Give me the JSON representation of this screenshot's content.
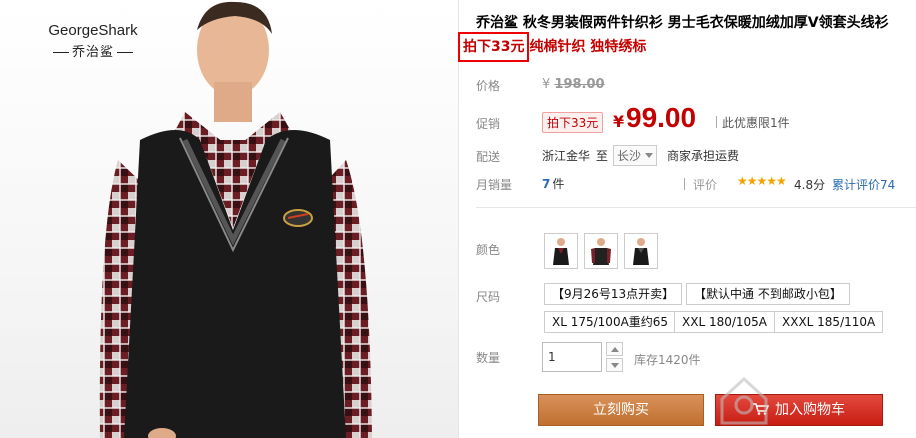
{
  "brand": {
    "name_en": "GeorgeShark",
    "name_cn": "乔治鲨"
  },
  "product": {
    "title": "乔治鲨 秋冬男装假两件针织衫 男士毛衣保暖加绒加厚V领套头线衫",
    "promo_highlight": "拍下33元",
    "promo_rest": "纯棉针织 独特绣标"
  },
  "price": {
    "label": "价格",
    "currency": "¥",
    "original": "198.00"
  },
  "promo": {
    "label": "促销",
    "badge": "拍下33元",
    "currency": "¥",
    "value": "99.00",
    "limit": "此优惠限1件"
  },
  "shipping": {
    "label": "配送",
    "from": "浙江金华",
    "to_word": "至",
    "to": "长沙",
    "freight": "商家承担运费"
  },
  "sales": {
    "label": "月销量",
    "count": "7",
    "unit": "件",
    "review_label": "评价",
    "stars": "★★★★★",
    "score": "4.8分",
    "review_count": "累计评价74"
  },
  "color": {
    "label": "颜色",
    "options": [
      "black-vest-1",
      "black-vest-2",
      "black-vest-3"
    ]
  },
  "size": {
    "label": "尺码",
    "row1": [
      "【9月26号13点开卖】",
      "【默认中通 不到邮政小包】"
    ],
    "row2": [
      "XL 175/100A重约65",
      "XXL 180/105A",
      "XXXL 185/110A"
    ]
  },
  "quantity": {
    "label": "数量",
    "value": "1",
    "stock": "库存1420件"
  },
  "actions": {
    "buy_now": "立刻购买",
    "add_cart": "加入购物车"
  },
  "colors": {
    "accent_red": "#c40000",
    "buy_orange": "#c98040",
    "cart_red": "#d4291e",
    "link_blue": "#2b6cb0"
  }
}
